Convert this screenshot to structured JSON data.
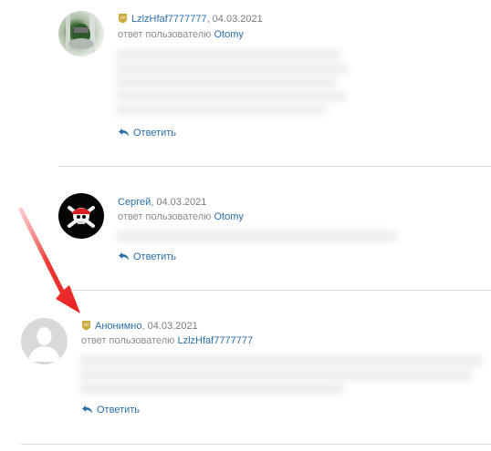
{
  "comments": [
    {
      "author": "LzlzHfaf7777777",
      "date": ", 04.03.2021",
      "vip": true,
      "reply_prefix": "ответ пользователю ",
      "reply_target": "Otomy",
      "reply_label": "Ответить"
    },
    {
      "author": "Сергей",
      "date": ", 04.03.2021",
      "vip": false,
      "reply_prefix": "ответ пользователю ",
      "reply_target": "Otomy",
      "reply_label": "Ответить"
    },
    {
      "author": "Анонимно",
      "date": ", 04.03.2021",
      "vip": true,
      "reply_prefix": "ответ пользователю ",
      "reply_target": "LzlzHfaf7777777",
      "reply_label": "Ответить"
    }
  ],
  "colors": {
    "link": "#2a6fa8",
    "vip_badge": "#c8a93a",
    "arrow": "#e8201e",
    "divider": "#d8dde3"
  },
  "icons": [
    "vip-badge-icon",
    "reply-arrow-icon",
    "default-avatar-icon",
    "pirate-skull-avatar"
  ]
}
